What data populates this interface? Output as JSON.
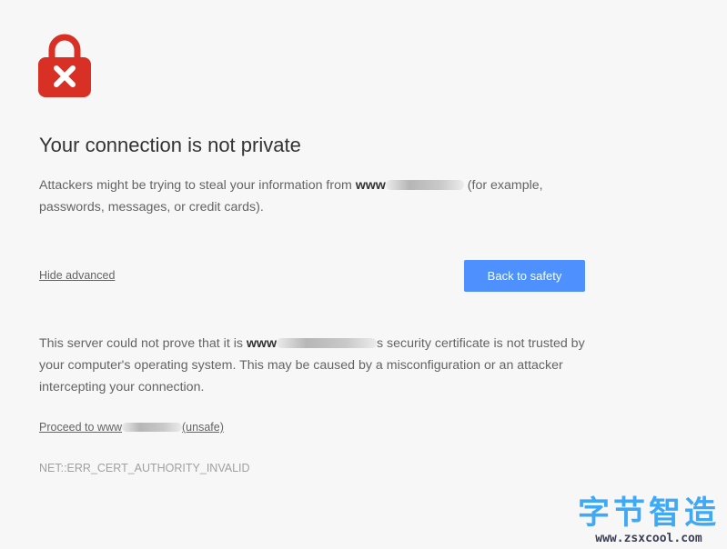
{
  "icons": {
    "lock": "lock-error-icon"
  },
  "colors": {
    "lock_red": "#d93025",
    "button_blue": "#4d90fe",
    "watermark_blue": "#3fa9f5"
  },
  "heading": "Your connection is not private",
  "intro": {
    "prefix": "Attackers might be trying to steal your information from ",
    "host": "www",
    "suffix": " (for example, passwords, messages, or credit cards)."
  },
  "hide_advanced_label": "Hide advanced",
  "back_button_label": "Back to safety",
  "details": {
    "prefix": "This server could not prove that it is ",
    "host": "www",
    "middle": "s security certificate is not trusted by your computer's operating system. This may be caused by a misconfiguration or an attacker intercepting your connection."
  },
  "proceed": {
    "prefix": "Proceed to www",
    "suffix": "(unsafe)"
  },
  "error_code": "NET::ERR_CERT_AUTHORITY_INVALID",
  "watermark": {
    "title": "字节智造",
    "url": "www.zsxcool.com"
  }
}
